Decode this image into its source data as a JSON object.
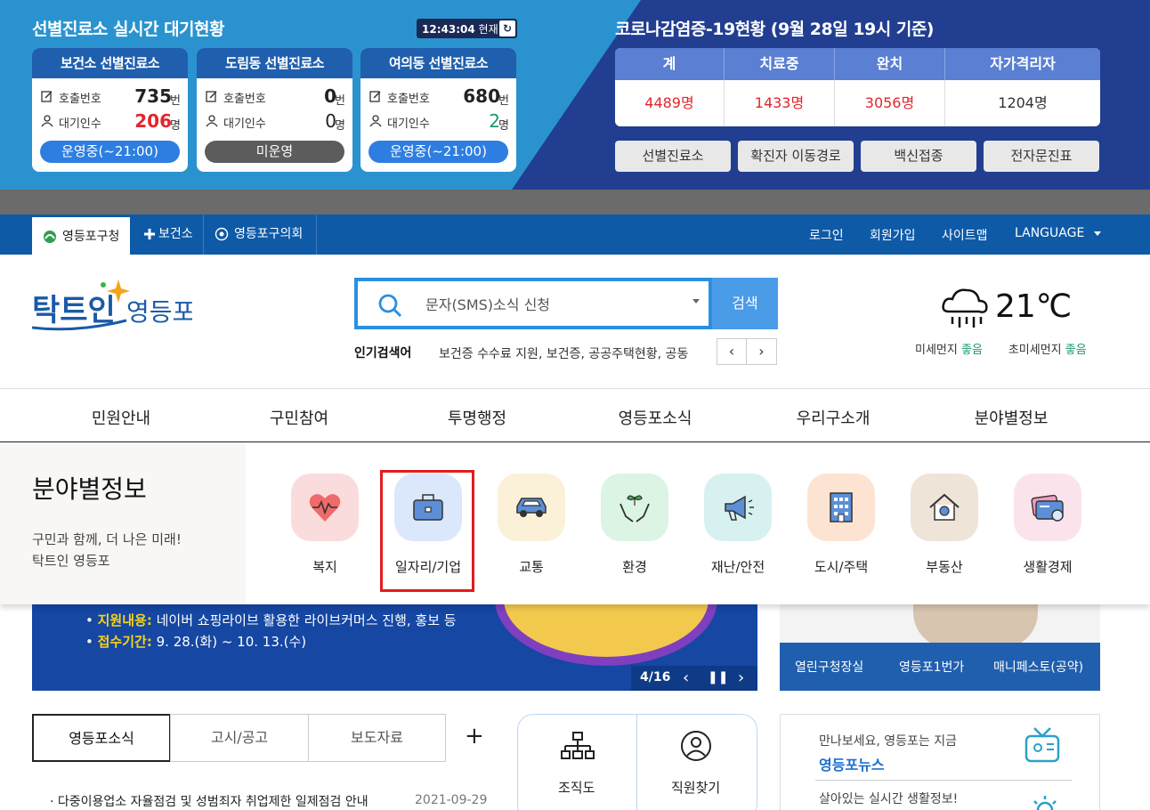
{
  "clinic": {
    "title": "선별진료소 실시간 대기현황",
    "clock_time": "12:43:04",
    "clock_suffix": "현재",
    "call_label": "호출번호",
    "wait_label": "대기인수",
    "unit_call": "번",
    "unit_wait": "명",
    "cards": [
      {
        "name": "보건소 선별진료소",
        "call": "735",
        "wait": "206",
        "status": "운영중(~21:00)"
      },
      {
        "name": "도림동 선별진료소",
        "call": "0",
        "wait": "0",
        "status": "미운영"
      },
      {
        "name": "여의동 선별진료소",
        "call": "680",
        "wait": "2",
        "status": "운영중(~21:00)"
      }
    ]
  },
  "covid": {
    "title": "코로나감염증-19현황 (9월 28일 19시 기준)",
    "headers": [
      "계",
      "치료중",
      "완치",
      "자가격리자"
    ],
    "values": [
      "4489명",
      "1433명",
      "3056명",
      "1204명"
    ],
    "buttons": [
      "선별진료소",
      "확진자 이동경로",
      "백신접종",
      "전자문진표"
    ]
  },
  "topnav": {
    "tabs": [
      "영등포구청",
      "보건소",
      "영등포구의회"
    ],
    "links": [
      "로그인",
      "회원가입",
      "사이트맵",
      "LANGUAGE"
    ]
  },
  "search": {
    "value": "문자(SMS)소식 신청",
    "button": "검색",
    "popular_label": "인기검색어",
    "popular_words": "보건증 수수료 지원, 보건증, 공공주택현황, 공동"
  },
  "weather": {
    "temp": "21℃",
    "dust_label": "미세먼지",
    "dust_value": "좋음",
    "fine_dust_label": "초미세먼지",
    "fine_dust_value": "좋음"
  },
  "gnb": [
    "민원안내",
    "구민참여",
    "투명행정",
    "영등포소식",
    "우리구소개",
    "분야별정보"
  ],
  "mega": {
    "title": "분야별정보",
    "sub1": "구민과 함께, 더 나은 미래!",
    "sub2": "탁트인 영등포",
    "items": [
      "복지",
      "일자리/기업",
      "교통",
      "환경",
      "재난/안전",
      "도시/주택",
      "부동산",
      "생활경제"
    ]
  },
  "hero": {
    "line1_key": "지원내용:",
    "line1": "네이버 쇼핑라이브 활용한 라이브커머스 진행, 홍보 등",
    "line2_key": "접수기간:",
    "line2": "9. 28.(화) ~ 10. 13.(수)",
    "page": "4/16"
  },
  "right_tabs": [
    "열린구청장실",
    "영등포1번가",
    "매니페스토(공약)"
  ],
  "news": {
    "tabs": [
      "영등포소식",
      "고시/공고",
      "보도자료"
    ],
    "plus": "+",
    "item_title": "다중이용업소 자율점검 및 성범죄자 취업제한 일제점검 안내",
    "item_date": "2021-09-29"
  },
  "quick": [
    "조직도",
    "직원찾기"
  ],
  "newsbox": {
    "line1": "만나보세요, 영등포는 지금",
    "line2": "영등포뉴스",
    "line3": "살아있는 실시간 생활정보!"
  },
  "colors": {
    "accent_blue": "#0e5aa7",
    "banner_blue": "#2a93cf",
    "highlight": "#e21c1c"
  }
}
